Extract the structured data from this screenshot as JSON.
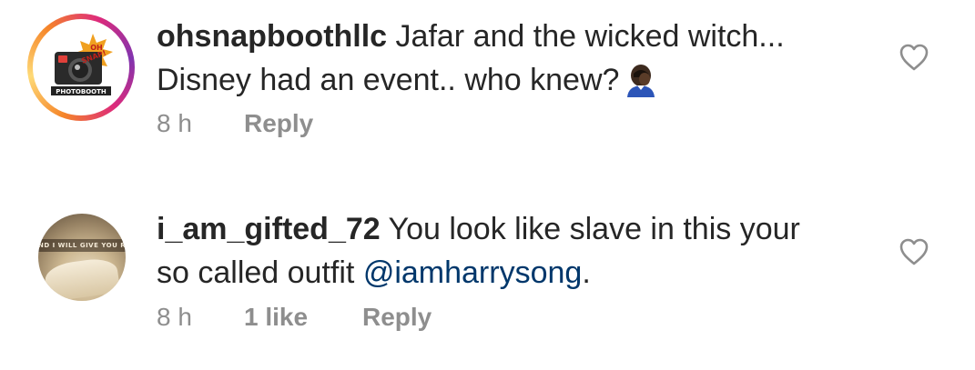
{
  "comments": [
    {
      "username": "ohsnapboothllc",
      "text_line1": "Jafar and the wicked witch...",
      "text_line2": "Disney had an event.. who knew?",
      "emoji": "face-palm-emoji",
      "time": "8 h",
      "likes": "",
      "reply_label": "Reply",
      "avatar": {
        "story_ring": true,
        "logo_text_top": "OH",
        "logo_text_mid": "SNAP!",
        "logo_text_bottom": "PHOTOBOOTH"
      }
    },
    {
      "username": "i_am_gifted_72",
      "text_line1": "You look like slave in this your",
      "text_line2": "so called outfit",
      "mention": "@iamharrysong",
      "text_end": ".",
      "time": "8 h",
      "likes": "1 like",
      "reply_label": "Reply",
      "avatar": {
        "story_ring": false,
        "banner_text": "ND I WILL GIVE YOU RE"
      }
    }
  ],
  "colors": {
    "text": "#262626",
    "meta": "#8e8e8e",
    "mention": "#00376b",
    "heart_outline": "#8e8e8e"
  },
  "icons": {
    "like": "heart-outline-icon"
  }
}
